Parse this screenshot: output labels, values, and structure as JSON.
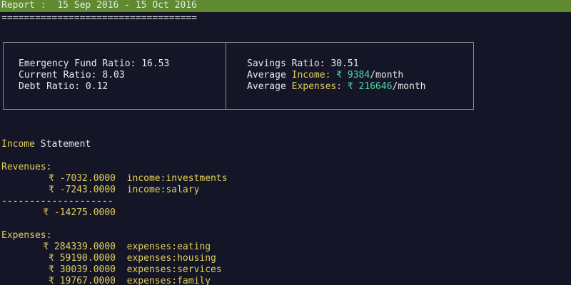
{
  "report": {
    "title_first_char": "R",
    "title_rest": "eport :  15 Sep 2016 - 15 Oct 2016",
    "underline": "==================================="
  },
  "ratios": {
    "emergency_fund_label": "Emergency Fund Ratio:",
    "emergency_fund_value": "16.53",
    "current_label": "Current Ratio:",
    "current_value": "8.03",
    "debt_label": "Debt Ratio:",
    "debt_value": "0.12",
    "savings_label": "Savings Ratio:",
    "savings_value": "30.51",
    "avg_income_prefix": "Average",
    "avg_income_word": "Income:",
    "avg_income_value": "₹ 9384",
    "avg_income_suffix": "/month",
    "avg_expenses_prefix": "Average",
    "avg_expenses_word": "Expenses:",
    "avg_expenses_value": "₹ 216646",
    "avg_expenses_suffix": "/month"
  },
  "income_statement": {
    "heading_word": "Income",
    "heading_rest": "Statement",
    "revenues_label": "Revenues:",
    "revenues": [
      {
        "amount": "₹ -7032.0000",
        "account": "income:investments"
      },
      {
        "amount": "₹ -7243.0000",
        "account": "income:salary"
      }
    ],
    "separator": "--------------------",
    "revenues_total": "₹ -14275.0000",
    "expenses_label": "Expenses:",
    "expenses": [
      {
        "amount": "₹ 284339.0000",
        "account": "expenses:eating"
      },
      {
        "amount": "₹ 59190.0000",
        "account": "expenses:housing"
      },
      {
        "amount": "₹ 30039.0000",
        "account": "expenses:services"
      },
      {
        "amount": "₹ 19767.0000",
        "account": "expenses:family"
      }
    ]
  },
  "colors": {
    "background": "#141627",
    "titlebar": "#5f8a30",
    "yellow": "#e2cf5a",
    "green": "#52d6a2"
  }
}
